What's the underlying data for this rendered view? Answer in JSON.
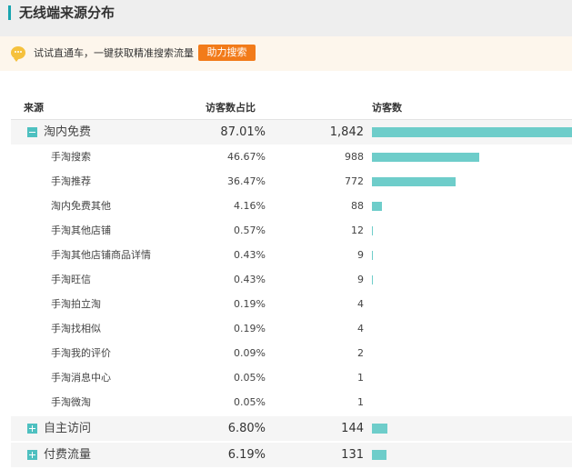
{
  "page": {
    "title": "无线端来源分布"
  },
  "promo": {
    "text": "试试直通车，一键获取精准搜索流量",
    "button_label": "助力搜索"
  },
  "table": {
    "headers": {
      "source": "来源",
      "visitor_share": "访客数占比",
      "visitors": "访客数"
    },
    "max_visitors": 1842,
    "groups": [
      {
        "name": "淘内免费",
        "share": "87.01%",
        "visitors": "1,842",
        "visitor_value": 1842,
        "expanded": true,
        "children": [
          {
            "name": "手淘搜索",
            "share": "46.67%",
            "visitors": "988",
            "visitor_value": 988
          },
          {
            "name": "手淘推荐",
            "share": "36.47%",
            "visitors": "772",
            "visitor_value": 772
          },
          {
            "name": "淘内免费其他",
            "share": "4.16%",
            "visitors": "88",
            "visitor_value": 88
          },
          {
            "name": "手淘其他店铺",
            "share": "0.57%",
            "visitors": "12",
            "visitor_value": 12
          },
          {
            "name": "手淘其他店铺商品详情",
            "share": "0.43%",
            "visitors": "9",
            "visitor_value": 9
          },
          {
            "name": "手淘旺信",
            "share": "0.43%",
            "visitors": "9",
            "visitor_value": 9
          },
          {
            "name": "手淘拍立淘",
            "share": "0.19%",
            "visitors": "4",
            "visitor_value": 4
          },
          {
            "name": "手淘找相似",
            "share": "0.19%",
            "visitors": "4",
            "visitor_value": 4
          },
          {
            "name": "手淘我的评价",
            "share": "0.09%",
            "visitors": "2",
            "visitor_value": 2
          },
          {
            "name": "手淘消息中心",
            "share": "0.05%",
            "visitors": "1",
            "visitor_value": 1
          },
          {
            "name": "手淘微淘",
            "share": "0.05%",
            "visitors": "1",
            "visitor_value": 1
          }
        ]
      },
      {
        "name": "自主访问",
        "share": "6.80%",
        "visitors": "144",
        "visitor_value": 144,
        "expanded": false,
        "children": []
      },
      {
        "name": "付费流量",
        "share": "6.19%",
        "visitors": "131",
        "visitor_value": 131,
        "expanded": false,
        "children": []
      }
    ]
  },
  "colors": {
    "accent": "#19a5b0",
    "bar": "#6ecdca",
    "toggle": "#4ec0c0",
    "button": "#f27b1a",
    "promo_bg": "#fdf6ec"
  }
}
